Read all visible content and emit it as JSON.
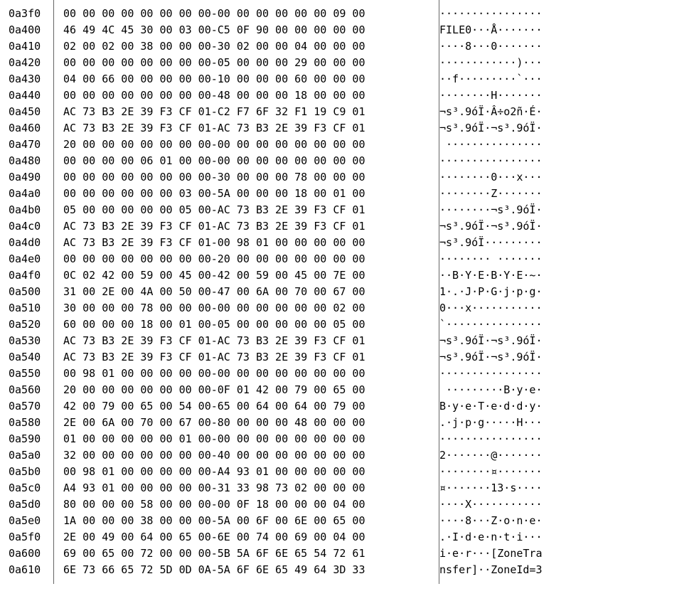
{
  "rows": [
    {
      "offset": "0a3f0",
      "hex": "00 00 00 00 00 00 00 00-00 00 00 00 00 00 09 00",
      "ascii": "················"
    },
    {
      "offset": "0a400",
      "hex": "46 49 4C 45 30 00 03 00-C5 0F 90 00 00 00 00 00",
      "ascii": "FILE0···Å·······"
    },
    {
      "offset": "0a410",
      "hex": "02 00 02 00 38 00 00 00-30 02 00 00 04 00 00 00",
      "ascii": "····8···0·······"
    },
    {
      "offset": "0a420",
      "hex": "00 00 00 00 00 00 00 00-05 00 00 00 29 00 00 00",
      "ascii": "············)···"
    },
    {
      "offset": "0a430",
      "hex": "04 00 66 00 00 00 00 00-10 00 00 00 60 00 00 00",
      "ascii": "··f·········`···"
    },
    {
      "offset": "0a440",
      "hex": "00 00 00 00 00 00 00 00-48 00 00 00 18 00 00 00",
      "ascii": "········H·······"
    },
    {
      "offset": "0a450",
      "hex": "AC 73 B3 2E 39 F3 CF 01-C2 F7 6F 32 F1 19 C9 01",
      "ascii": "¬s³.9óÏ·Â÷o2ñ·É·"
    },
    {
      "offset": "0a460",
      "hex": "AC 73 B3 2E 39 F3 CF 01-AC 73 B3 2E 39 F3 CF 01",
      "ascii": "¬s³.9óÏ·¬s³.9óÏ·"
    },
    {
      "offset": "0a470",
      "hex": "20 00 00 00 00 00 00 00-00 00 00 00 00 00 00 00",
      "ascii": " ···············"
    },
    {
      "offset": "0a480",
      "hex": "00 00 00 00 06 01 00 00-00 00 00 00 00 00 00 00",
      "ascii": "················"
    },
    {
      "offset": "0a490",
      "hex": "00 00 00 00 00 00 00 00-30 00 00 00 78 00 00 00",
      "ascii": "········0···x···"
    },
    {
      "offset": "0a4a0",
      "hex": "00 00 00 00 00 00 03 00-5A 00 00 00 18 00 01 00",
      "ascii": "········Z·······"
    },
    {
      "offset": "0a4b0",
      "hex": "05 00 00 00 00 00 05 00-AC 73 B3 2E 39 F3 CF 01",
      "ascii": "········¬s³.9óÏ·"
    },
    {
      "offset": "0a4c0",
      "hex": "AC 73 B3 2E 39 F3 CF 01-AC 73 B3 2E 39 F3 CF 01",
      "ascii": "¬s³.9óÏ·¬s³.9óÏ·"
    },
    {
      "offset": "0a4d0",
      "hex": "AC 73 B3 2E 39 F3 CF 01-00 98 01 00 00 00 00 00",
      "ascii": "¬s³.9óÏ·········"
    },
    {
      "offset": "0a4e0",
      "hex": "00 00 00 00 00 00 00 00-20 00 00 00 00 00 00 00",
      "ascii": "········ ·······"
    },
    {
      "offset": "0a4f0",
      "hex": "0C 02 42 00 59 00 45 00-42 00 59 00 45 00 7E 00",
      "ascii": "··B·Y·E·B·Y·E·~·"
    },
    {
      "offset": "0a500",
      "hex": "31 00 2E 00 4A 00 50 00-47 00 6A 00 70 00 67 00",
      "ascii": "1·.·J·P·G·j·p·g·"
    },
    {
      "offset": "0a510",
      "hex": "30 00 00 00 78 00 00 00-00 00 00 00 00 00 02 00",
      "ascii": "0···x···········"
    },
    {
      "offset": "0a520",
      "hex": "60 00 00 00 18 00 01 00-05 00 00 00 00 00 05 00",
      "ascii": "`···············"
    },
    {
      "offset": "0a530",
      "hex": "AC 73 B3 2E 39 F3 CF 01-AC 73 B3 2E 39 F3 CF 01",
      "ascii": "¬s³.9óÏ·¬s³.9óÏ·"
    },
    {
      "offset": "0a540",
      "hex": "AC 73 B3 2E 39 F3 CF 01-AC 73 B3 2E 39 F3 CF 01",
      "ascii": "¬s³.9óÏ·¬s³.9óÏ·"
    },
    {
      "offset": "0a550",
      "hex": "00 98 01 00 00 00 00 00-00 00 00 00 00 00 00 00",
      "ascii": "················"
    },
    {
      "offset": "0a560",
      "hex": "20 00 00 00 00 00 00 00-0F 01 42 00 79 00 65 00",
      "ascii": " ·········B·y·e·"
    },
    {
      "offset": "0a570",
      "hex": "42 00 79 00 65 00 54 00-65 00 64 00 64 00 79 00",
      "ascii": "B·y·e·T·e·d·d·y·"
    },
    {
      "offset": "0a580",
      "hex": "2E 00 6A 00 70 00 67 00-80 00 00 00 48 00 00 00",
      "ascii": ".·j·p·g·····H···"
    },
    {
      "offset": "0a590",
      "hex": "01 00 00 00 00 00 01 00-00 00 00 00 00 00 00 00",
      "ascii": "················"
    },
    {
      "offset": "0a5a0",
      "hex": "32 00 00 00 00 00 00 00-40 00 00 00 00 00 00 00",
      "ascii": "2·······@·······"
    },
    {
      "offset": "0a5b0",
      "hex": "00 98 01 00 00 00 00 00-A4 93 01 00 00 00 00 00",
      "ascii": "········¤·······"
    },
    {
      "offset": "0a5c0",
      "hex": "A4 93 01 00 00 00 00 00-31 33 98 73 02 00 00 00",
      "ascii": "¤·······13·s····"
    },
    {
      "offset": "0a5d0",
      "hex": "80 00 00 00 58 00 00 00-00 0F 18 00 00 00 04 00",
      "ascii": "····X···········"
    },
    {
      "offset": "0a5e0",
      "hex": "1A 00 00 00 38 00 00 00-5A 00 6F 00 6E 00 65 00",
      "ascii": "····8···Z·o·n·e·"
    },
    {
      "offset": "0a5f0",
      "hex": "2E 00 49 00 64 00 65 00-6E 00 74 00 69 00 04 00",
      "ascii": ".·I·d·e·n·t·i···"
    },
    {
      "offset": "0a600",
      "hex": "69 00 65 00 72 00 00 00-5B 5A 6F 6E 65 54 72 61",
      "ascii": "i·e·r···[ZoneTra"
    },
    {
      "offset": "0a610",
      "hex": "6E 73 66 65 72 5D 0D 0A-5A 6F 6E 65 49 64 3D 33",
      "ascii": "nsfer]··ZoneId=3"
    }
  ]
}
